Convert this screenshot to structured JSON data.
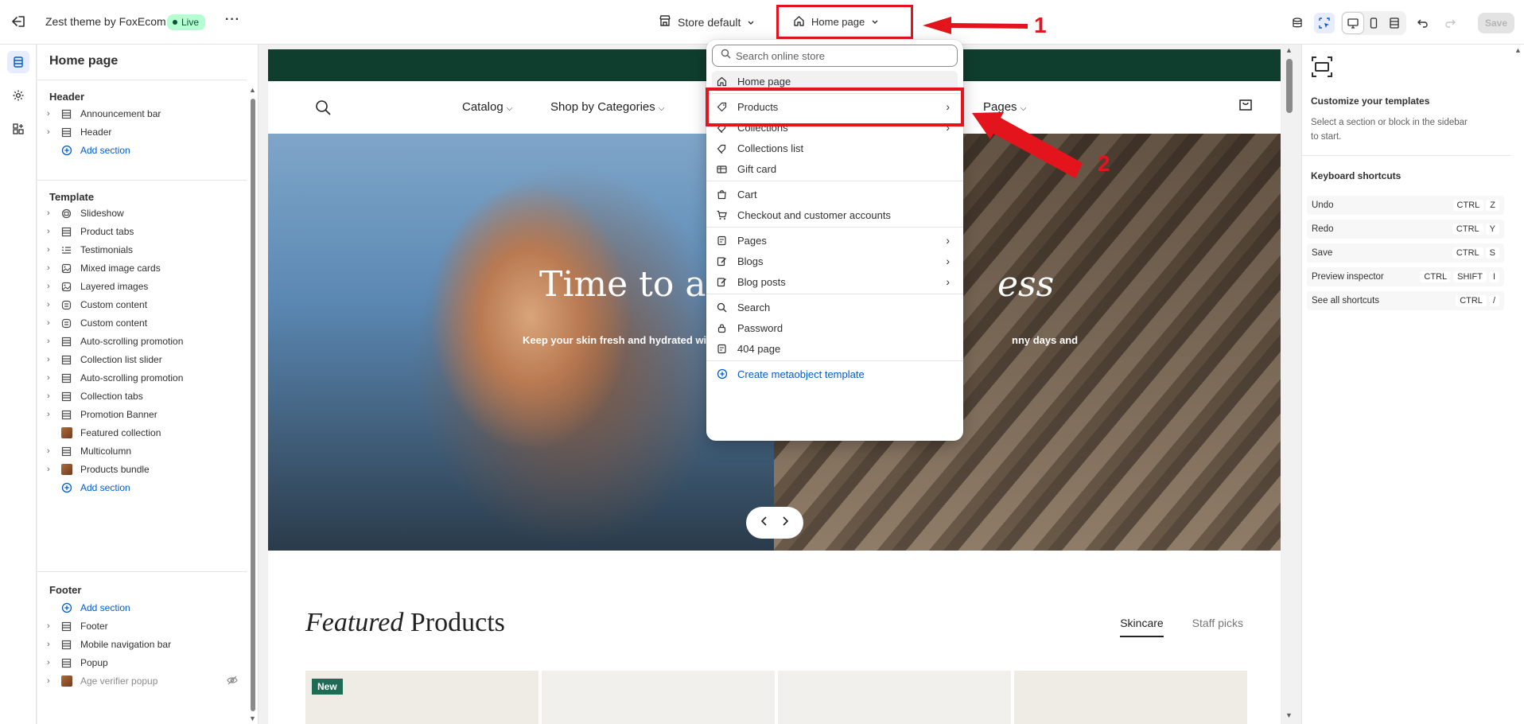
{
  "topbar": {
    "theme_name": "Zest theme by FoxEcom",
    "live_badge": "Live",
    "more": "···",
    "store_selector": "Store default",
    "page_selector": "Home page",
    "save_label": "Save"
  },
  "sidebar": {
    "title": "Home page",
    "header_section": {
      "heading": "Header",
      "items": [
        {
          "label": "Announcement bar",
          "icon": "section-icon"
        },
        {
          "label": "Header",
          "icon": "section-icon"
        }
      ],
      "add_label": "Add section"
    },
    "template_section": {
      "heading": "Template",
      "items": [
        {
          "label": "Slideshow",
          "icon": "slideshow-icon"
        },
        {
          "label": "Product tabs",
          "icon": "section-icon"
        },
        {
          "label": "Testimonials",
          "icon": "list-icon"
        },
        {
          "label": "Mixed image cards",
          "icon": "image-icon"
        },
        {
          "label": "Layered images",
          "icon": "image-icon"
        },
        {
          "label": "Custom content",
          "icon": "content-icon"
        },
        {
          "label": "Custom content",
          "icon": "content-icon"
        },
        {
          "label": "Auto-scrolling promotion",
          "icon": "section-icon"
        },
        {
          "label": "Collection list slider",
          "icon": "section-icon"
        },
        {
          "label": "Auto-scrolling promotion",
          "icon": "section-icon"
        },
        {
          "label": "Collection tabs",
          "icon": "section-icon"
        },
        {
          "label": "Promotion Banner",
          "icon": "section-icon"
        },
        {
          "label": "Featured collection",
          "icon": "thumbnail"
        },
        {
          "label": "Multicolumn",
          "icon": "section-icon"
        },
        {
          "label": "Products bundle",
          "icon": "thumbnail"
        }
      ],
      "add_label": "Add section"
    },
    "footer_section": {
      "heading": "Footer",
      "add_label": "Add section",
      "items": [
        {
          "label": "Footer",
          "icon": "section-icon"
        },
        {
          "label": "Mobile navigation bar",
          "icon": "section-icon"
        },
        {
          "label": "Popup",
          "icon": "section-icon"
        },
        {
          "label": "Age verifier popup",
          "icon": "thumbnail"
        }
      ]
    }
  },
  "preview": {
    "nav": {
      "menu": [
        "Catalog",
        "Shop by Categories",
        "Pages"
      ]
    },
    "hero": {
      "title_left": "Time to ac",
      "title_right": "ess",
      "subtitle_left": "Keep your skin fresh and hydrated wit",
      "subtitle_right": "nny days and"
    },
    "featured": {
      "title_italic": "Featured",
      "title_rest": "Products",
      "tabs": [
        "Skincare",
        "Staff picks"
      ],
      "badge": "New"
    }
  },
  "dropdown": {
    "search_placeholder": "Search online store",
    "groups": [
      [
        {
          "label": "Home page",
          "icon": "home-icon",
          "selected": true
        }
      ],
      [
        {
          "label": "Products",
          "icon": "tag-icon",
          "submenu": true
        },
        {
          "label": "Collections",
          "icon": "collection-icon",
          "submenu": true
        },
        {
          "label": "Collections list",
          "icon": "collection-icon"
        },
        {
          "label": "Gift card",
          "icon": "gift-card-icon"
        }
      ],
      [
        {
          "label": "Cart",
          "icon": "bag-icon"
        },
        {
          "label": "Checkout and customer accounts",
          "icon": "cart-icon"
        }
      ],
      [
        {
          "label": "Pages",
          "icon": "page-icon",
          "submenu": true
        },
        {
          "label": "Blogs",
          "icon": "edit-icon",
          "submenu": true
        },
        {
          "label": "Blog posts",
          "icon": "edit-icon",
          "submenu": true
        }
      ],
      [
        {
          "label": "Search",
          "icon": "search-icon"
        },
        {
          "label": "Password",
          "icon": "lock-icon"
        },
        {
          "label": "404 page",
          "icon": "page-icon"
        }
      ]
    ],
    "create_label": "Create metaobject template"
  },
  "right_panel": {
    "title": "Customize your templates",
    "description": "Select a section or block in the sidebar to start.",
    "shortcuts_title": "Keyboard shortcuts",
    "shortcuts": [
      {
        "label": "Undo",
        "keys": [
          "CTRL",
          "Z"
        ]
      },
      {
        "label": "Redo",
        "keys": [
          "CTRL",
          "Y"
        ]
      },
      {
        "label": "Save",
        "keys": [
          "CTRL",
          "S"
        ]
      },
      {
        "label": "Preview inspector",
        "keys": [
          "CTRL",
          "SHIFT",
          "I"
        ]
      },
      {
        "label": "See all shortcuts",
        "keys": [
          "CTRL",
          "/"
        ]
      }
    ]
  },
  "annotations": {
    "step1": "1",
    "step2": "2",
    "color": "#e3141c"
  }
}
